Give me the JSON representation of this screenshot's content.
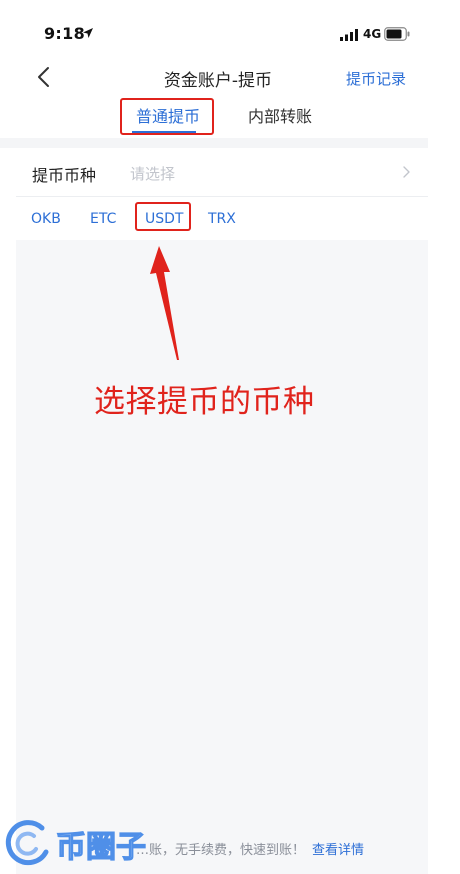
{
  "status_bar": {
    "time": "9:18",
    "network": "4G"
  },
  "nav": {
    "title": "资金账户-提币",
    "right_link": "提币记录"
  },
  "tabs": [
    {
      "label": "普通提币",
      "active": true
    },
    {
      "label": "内部转账",
      "active": false
    }
  ],
  "coin_select": {
    "label": "提币币种",
    "placeholder": "请选择"
  },
  "coins": [
    "OKB",
    "ETC",
    "USDT",
    "TRX"
  ],
  "annotation": {
    "text": "选择提币的币种",
    "color": "#e0231c"
  },
  "footer": {
    "note": "…账，无手续费，快速到账！",
    "link": "查看详情"
  },
  "watermark": {
    "text": "币圈子"
  },
  "colors": {
    "accent": "#2d6fd6",
    "highlight": "#e0231c",
    "panel": "#f6f7f9"
  }
}
